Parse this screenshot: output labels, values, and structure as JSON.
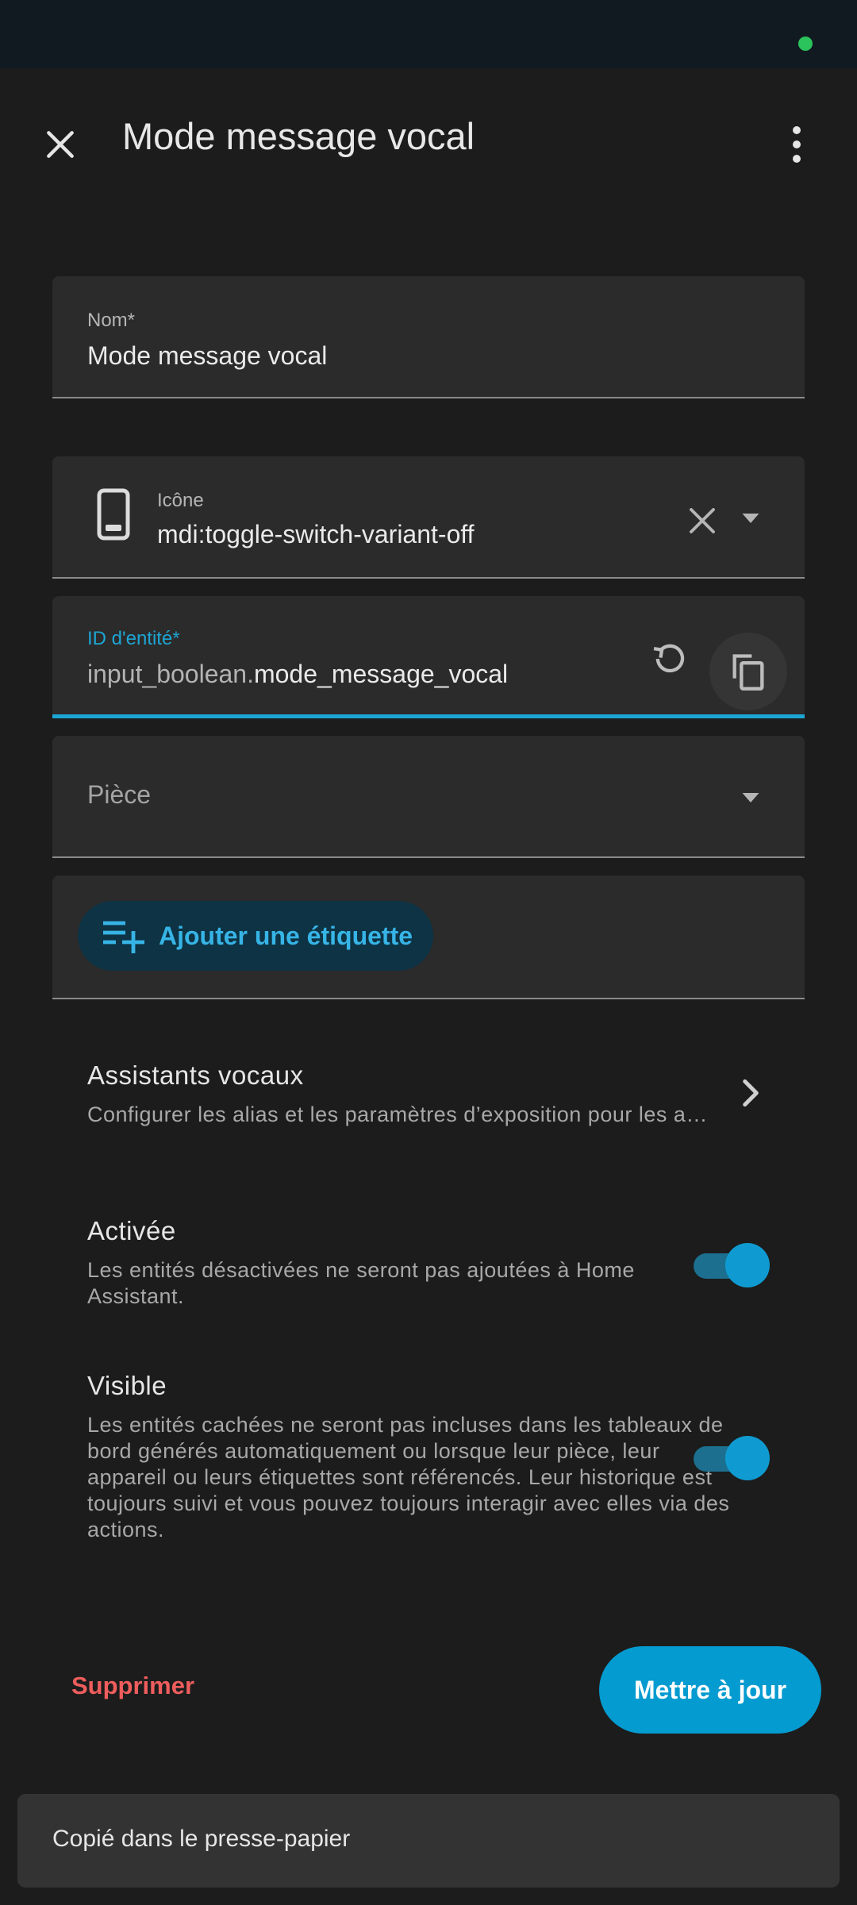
{
  "colors": {
    "accent": "#1da5d4",
    "danger": "#ef5d5d",
    "background": "#1c1c1c",
    "field": "#2b2b2b",
    "status_dot": "#2bc35c"
  },
  "header": {
    "title": "Mode message vocal",
    "close_icon": "close-icon",
    "menu_icon": "more-vertical-icon"
  },
  "form": {
    "name": {
      "label": "Nom*",
      "value": "Mode message vocal"
    },
    "icon": {
      "label": "Icône",
      "value": "mdi:toggle-switch-variant-off",
      "preview_icon": "cellphone-icon"
    },
    "entity_id": {
      "label": "ID d'entité*",
      "prefix": "input_boolean.",
      "value": "mode_message_vocal"
    },
    "room": {
      "placeholder": "Pièce"
    },
    "tags": {
      "add_label": "Ajouter une étiquette"
    }
  },
  "settings": {
    "assistants": {
      "title": "Assistants vocaux",
      "subtitle": "Configurer les alias et les paramètres d’exposition pour les assistants vocaux"
    },
    "enabled": {
      "title": "Activée",
      "subtitle": "Les entités désactivées ne seront pas ajoutées à Home Assistant.",
      "on": true
    },
    "visible": {
      "title": "Visible",
      "subtitle": "Les entités cachées ne seront pas incluses dans les tableaux de bord générés automatiquement ou lorsque leur pièce, leur appareil ou leurs étiquettes sont référencés. Leur historique est toujours suivi et vous pouvez toujours interagir avec elles via des actions.",
      "on": true
    }
  },
  "actions": {
    "delete": "Supprimer",
    "update": "Mettre à jour"
  },
  "snackbar": {
    "message": "Copié dans le presse-papier"
  }
}
